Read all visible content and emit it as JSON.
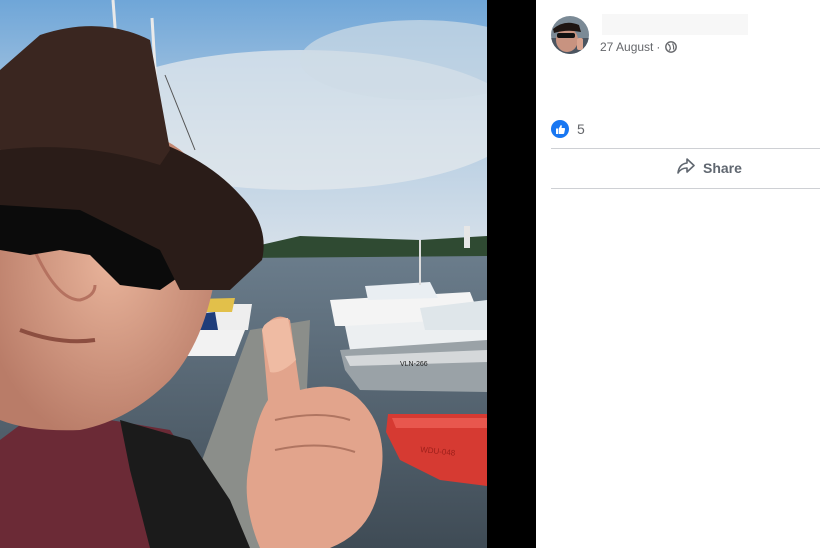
{
  "post": {
    "date": "27 August",
    "separator": "·",
    "privacy_icon": "globe-icon"
  },
  "reactions": {
    "icon": "like-icon",
    "count": "5"
  },
  "actions": {
    "share_icon": "share-arrow-icon",
    "share_label": "Share"
  },
  "photo": {
    "boat_left_reg": "VLN-266",
    "boat_red_reg": "WDU-048"
  },
  "colors": {
    "link_blue": "#1877f2",
    "meta_gray": "#65676b",
    "divider": "#ced0d4"
  }
}
